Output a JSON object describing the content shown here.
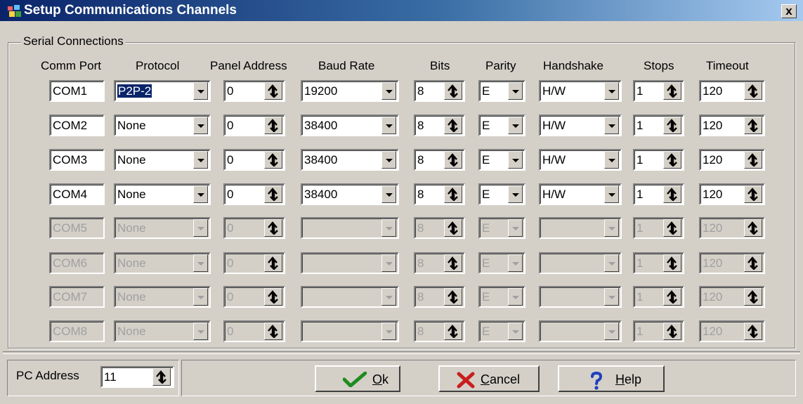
{
  "window": {
    "title": "Setup Communications Channels",
    "close_label": "x"
  },
  "group": {
    "label": "Serial Connections"
  },
  "columns": [
    "Comm Port",
    "Protocol",
    "Panel Address",
    "Baud Rate",
    "Bits",
    "Parity",
    "Handshake",
    "Stops",
    "Timeout"
  ],
  "rows": [
    {
      "port": "COM1",
      "protocol": "P2P-2",
      "address": "0",
      "baud": "19200",
      "bits": "8",
      "parity": "E",
      "handshake": "H/W",
      "stops": "1",
      "timeout": "120",
      "enabled": true
    },
    {
      "port": "COM2",
      "protocol": "None",
      "address": "0",
      "baud": "38400",
      "bits": "8",
      "parity": "E",
      "handshake": "H/W",
      "stops": "1",
      "timeout": "120",
      "enabled": true
    },
    {
      "port": "COM3",
      "protocol": "None",
      "address": "0",
      "baud": "38400",
      "bits": "8",
      "parity": "E",
      "handshake": "H/W",
      "stops": "1",
      "timeout": "120",
      "enabled": true
    },
    {
      "port": "COM4",
      "protocol": "None",
      "address": "0",
      "baud": "38400",
      "bits": "8",
      "parity": "E",
      "handshake": "H/W",
      "stops": "1",
      "timeout": "120",
      "enabled": true
    },
    {
      "port": "COM5",
      "protocol": "None",
      "address": "0",
      "baud": "",
      "bits": "8",
      "parity": "E",
      "handshake": "",
      "stops": "1",
      "timeout": "120",
      "enabled": false
    },
    {
      "port": "COM6",
      "protocol": "None",
      "address": "0",
      "baud": "",
      "bits": "8",
      "parity": "E",
      "handshake": "",
      "stops": "1",
      "timeout": "120",
      "enabled": false
    },
    {
      "port": "COM7",
      "protocol": "None",
      "address": "0",
      "baud": "",
      "bits": "8",
      "parity": "E",
      "handshake": "",
      "stops": "1",
      "timeout": "120",
      "enabled": false
    },
    {
      "port": "COM8",
      "protocol": "None",
      "address": "0",
      "baud": "",
      "bits": "8",
      "parity": "E",
      "handshake": "",
      "stops": "1",
      "timeout": "120",
      "enabled": false
    }
  ],
  "footer": {
    "pc_address_label": "PC Address",
    "pc_address_value": "11",
    "ok_label": "Ok",
    "cancel_label": "Cancel",
    "help_label": "Help"
  },
  "icons": {
    "ok": "checkmark-icon",
    "cancel": "x-icon",
    "help": "question-icon",
    "spin": "spinner-icon",
    "app": "app-icon"
  },
  "colors": {
    "title_start": "#0a246a",
    "title_end": "#a6caf0",
    "ok": "#1e8c1e",
    "cancel": "#c81e1e",
    "help": "#1f3fbf"
  }
}
